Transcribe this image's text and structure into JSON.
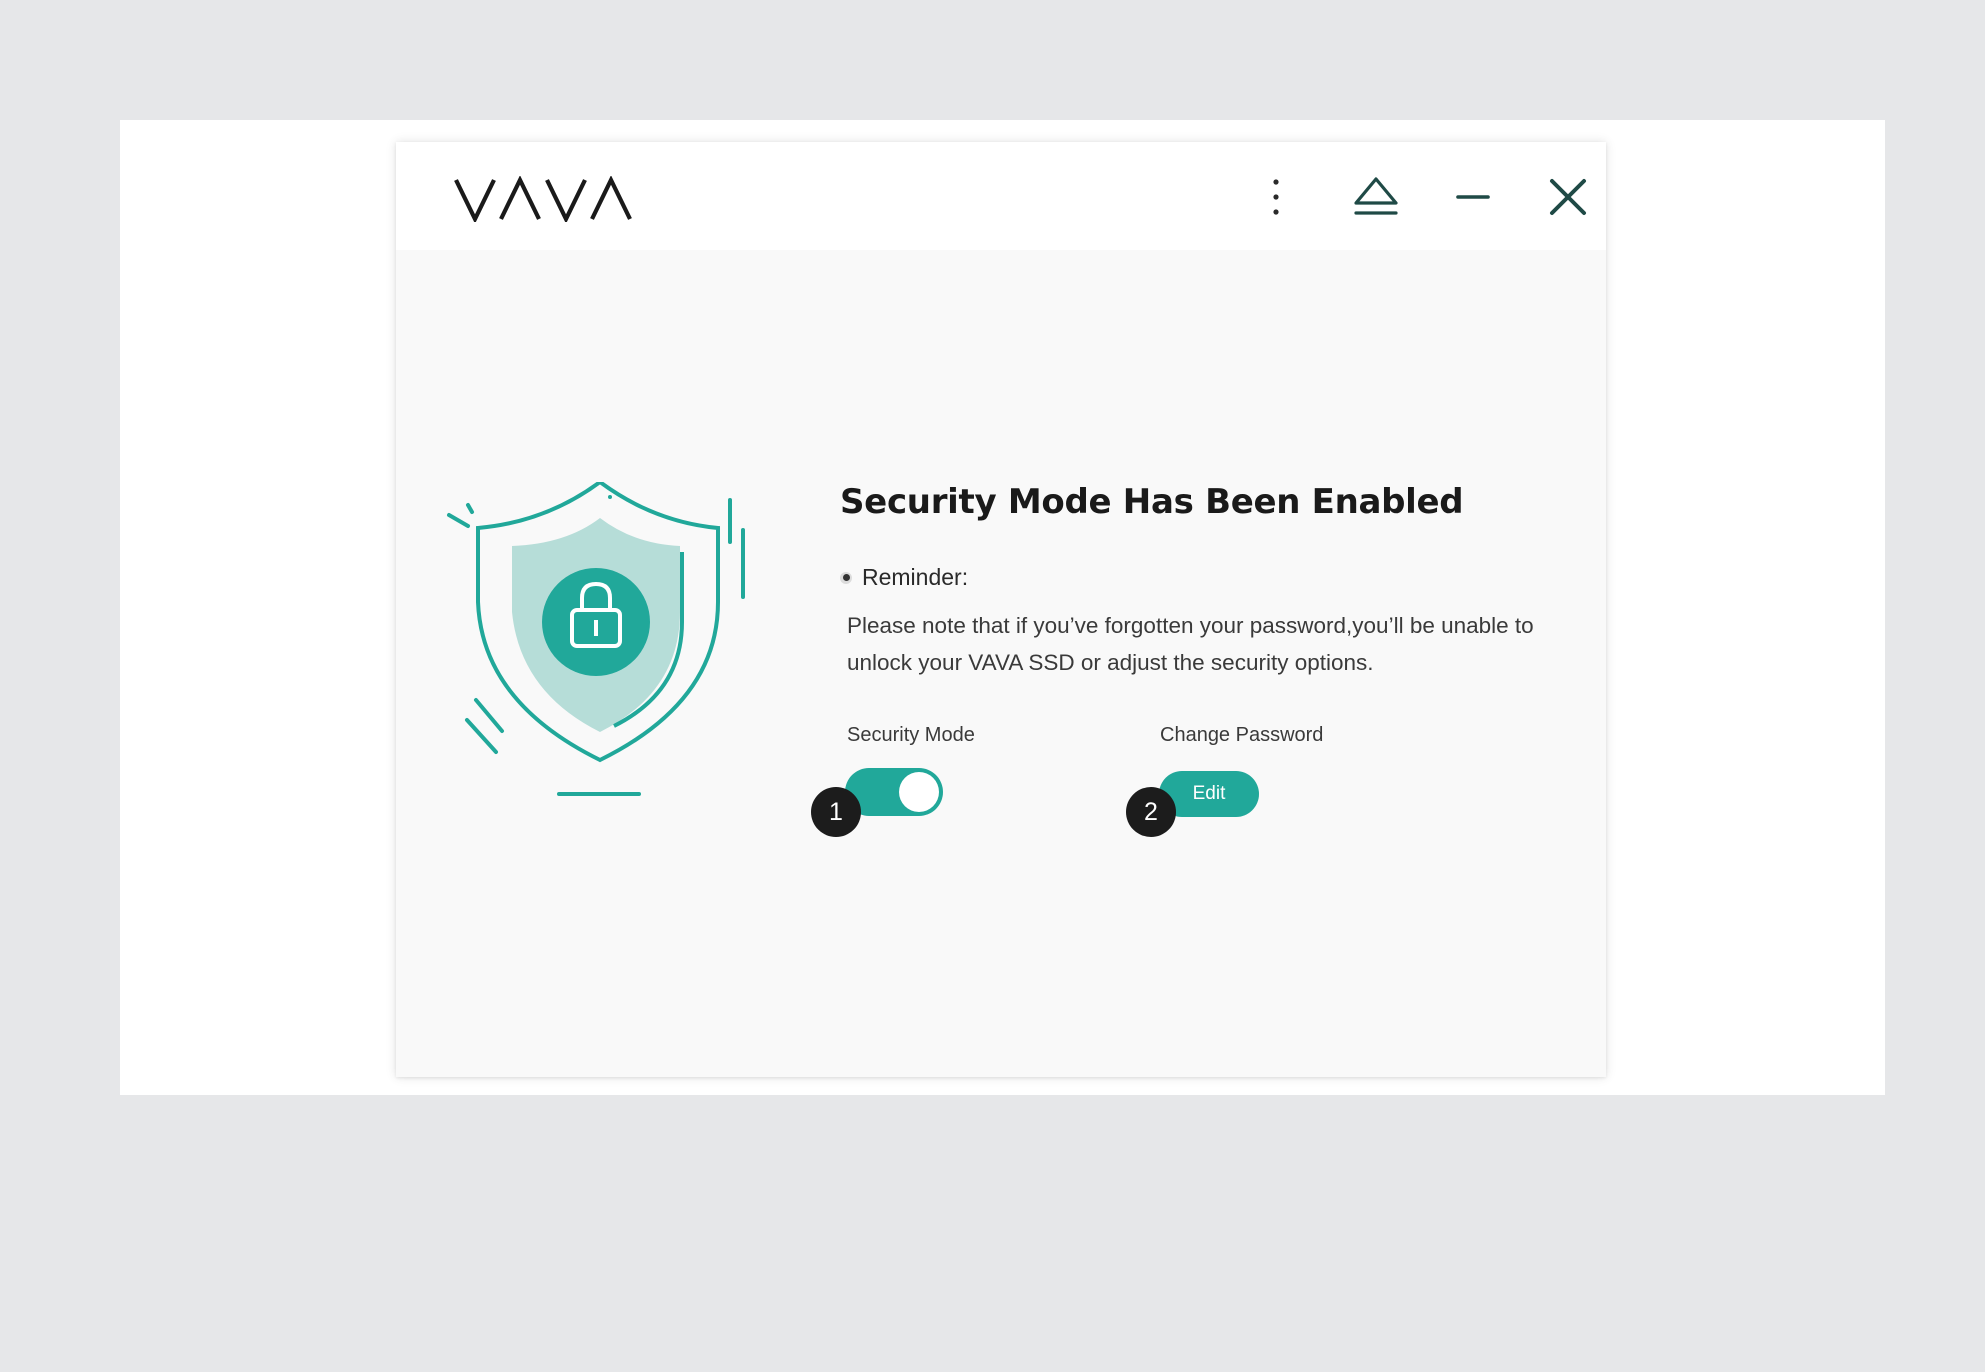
{
  "app": {
    "brand": "VAVA",
    "accent_color": "#21a89a"
  },
  "titlebar": {
    "buttons": [
      {
        "name": "more",
        "icon": "more-vertical-icon"
      },
      {
        "name": "eject",
        "icon": "eject-icon"
      },
      {
        "name": "minimize",
        "icon": "minimize-icon"
      },
      {
        "name": "close",
        "icon": "close-icon"
      }
    ]
  },
  "main": {
    "illustration_icon": "shield-lock-icon",
    "headline": "Security Mode Has Been Enabled",
    "reminder_label": "Reminder:",
    "reminder_text": "Please note that if you’ve forgotten your password,you’ll be unable to unlock your VAVA SSD or adjust the security options.",
    "security_mode": {
      "label": "Security Mode",
      "enabled": true
    },
    "change_password": {
      "label": "Change Password",
      "button_label": "Edit"
    }
  },
  "annotations": {
    "marker_1": "1",
    "marker_2": "2"
  }
}
